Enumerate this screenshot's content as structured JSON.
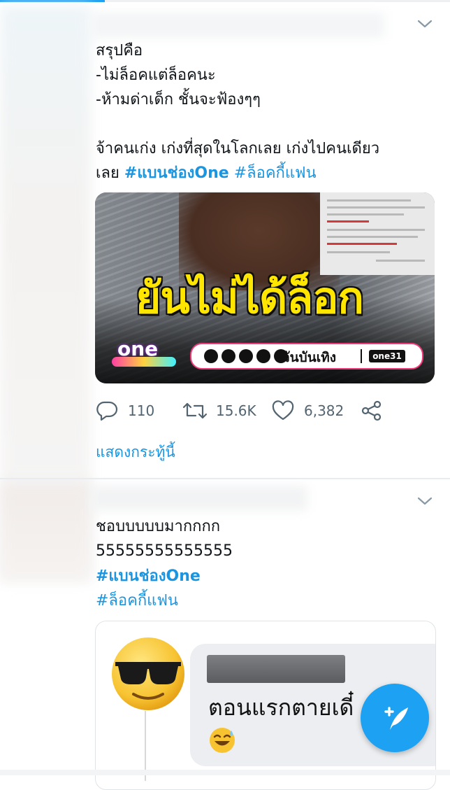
{
  "tweet1": {
    "lines": [
      "สรุปคือ",
      "-ไม่ล็อคแต่ล็อคนะ",
      "-ห้ามด่าเด็ก ชั้นจะฟ้องๆๆ",
      "",
      "จ้าคนเก่ง เก่งที่สุดในโลกเลย เก่งไปคนเดียว"
    ],
    "last_line_prefix": "เลย",
    "hashtags": [
      "#แบนช่องOne",
      "#ล็อคกี้แฟน"
    ],
    "media": {
      "headline": "ยันไม่ได้ล็อก",
      "logo_text": "one",
      "social_label": "วันบันเทิง",
      "brand_badge": "one31"
    },
    "actions": {
      "replies": "110",
      "retweets": "15.6K",
      "likes": "6,382"
    },
    "show_thread": "แสดงกระทู้นี้"
  },
  "tweet2": {
    "lines": [
      "ชอบบบบบมากกกก",
      "55555555555555"
    ],
    "hashtags": [
      "#แบนช่องOne",
      "#ล็อคกี้แฟน"
    ],
    "quote": {
      "bubble_text": "ตอนแรกตายเดี๋"
    }
  },
  "colors": {
    "accent": "#1da1f2",
    "hashtag": "#1b95e0",
    "icon_gray": "#536471",
    "headline_yellow": "#ffe600"
  },
  "icons": {
    "reply": "speech-bubble-icon",
    "retweet": "retweet-icon",
    "like": "heart-icon",
    "share": "share-icon",
    "menu": "chevron-down-icon",
    "compose": "feather-plus-icon"
  }
}
